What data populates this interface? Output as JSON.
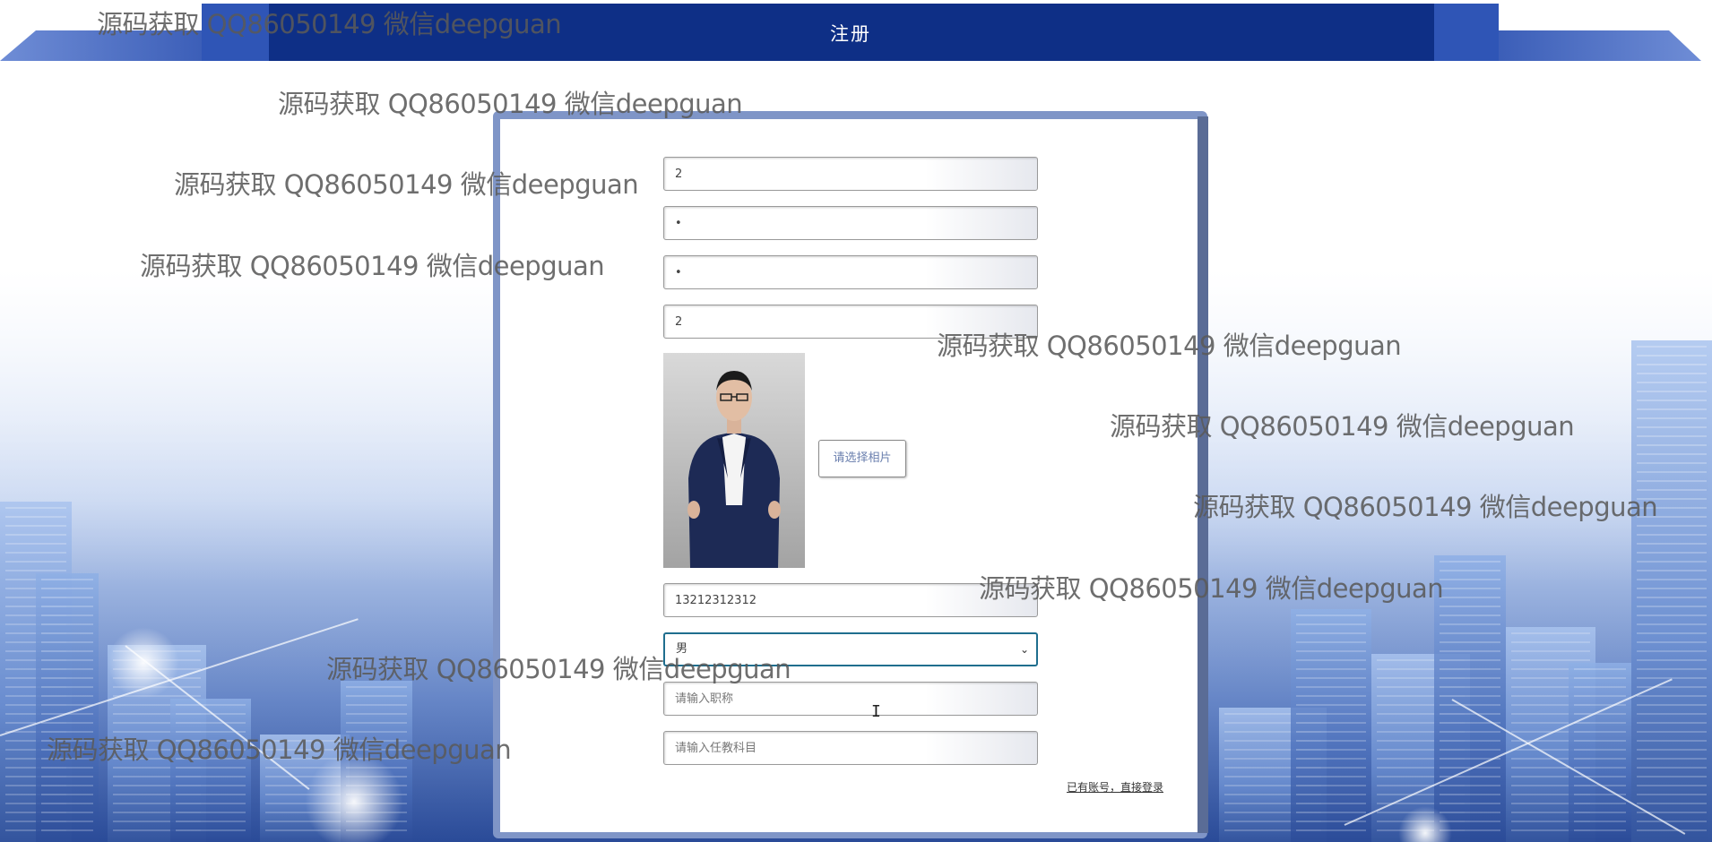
{
  "header": {
    "title": "注册"
  },
  "form": {
    "fields": [
      {
        "name": "field-1",
        "value": "2",
        "placeholder": ""
      },
      {
        "name": "field-2",
        "value": "•",
        "placeholder": ""
      },
      {
        "name": "field-3",
        "value": "•",
        "placeholder": ""
      },
      {
        "name": "field-4",
        "value": "2",
        "placeholder": ""
      }
    ],
    "photo_button_label": "请选择相片",
    "phone": {
      "value": "13212312312"
    },
    "gender": {
      "selected": "男"
    },
    "title_field": {
      "placeholder": "请输入职称"
    },
    "subject_field": {
      "placeholder": "请输入任教科目"
    },
    "login_link": "已有账号，直接登录"
  },
  "watermark": {
    "text": "源码获取 QQ86050149 微信deepguan"
  },
  "colors": {
    "header_bar": "#0e2f86",
    "card_frame": "#7f95c7",
    "select_border": "#1f6e8e"
  }
}
